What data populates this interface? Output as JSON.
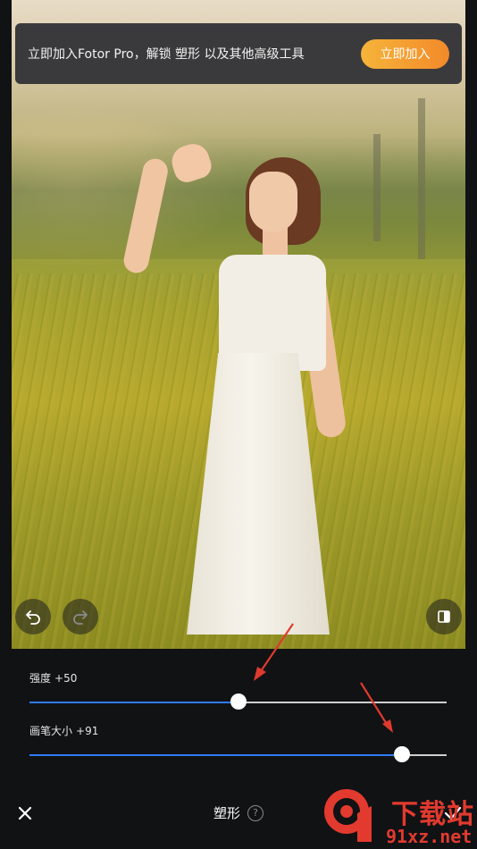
{
  "promo": {
    "text": "立即加入Fotor Pro，解锁 塑形 以及其他高级工具",
    "button_label": "立即加入"
  },
  "photo": {
    "controls": {
      "undo_icon": "undo-icon",
      "redo_icon": "redo-icon",
      "compare_icon": "compare-icon"
    }
  },
  "sliders": [
    {
      "label": "强度",
      "value_text": "+50",
      "fraction": 0.5
    },
    {
      "label": "画笔大小",
      "value_text": "+91",
      "fraction": 0.894
    }
  ],
  "bottom_bar": {
    "close_icon": "close-icon",
    "title": "塑形",
    "help_glyph": "?",
    "confirm_icon": "check-icon"
  },
  "watermark": {
    "text_top": "下载站",
    "text_bottom": "91xz.net"
  },
  "colors": {
    "accent": "#2f7cf6",
    "promo_button": "#f6a433",
    "background": "#111214",
    "annotation": "#e03a2e"
  }
}
